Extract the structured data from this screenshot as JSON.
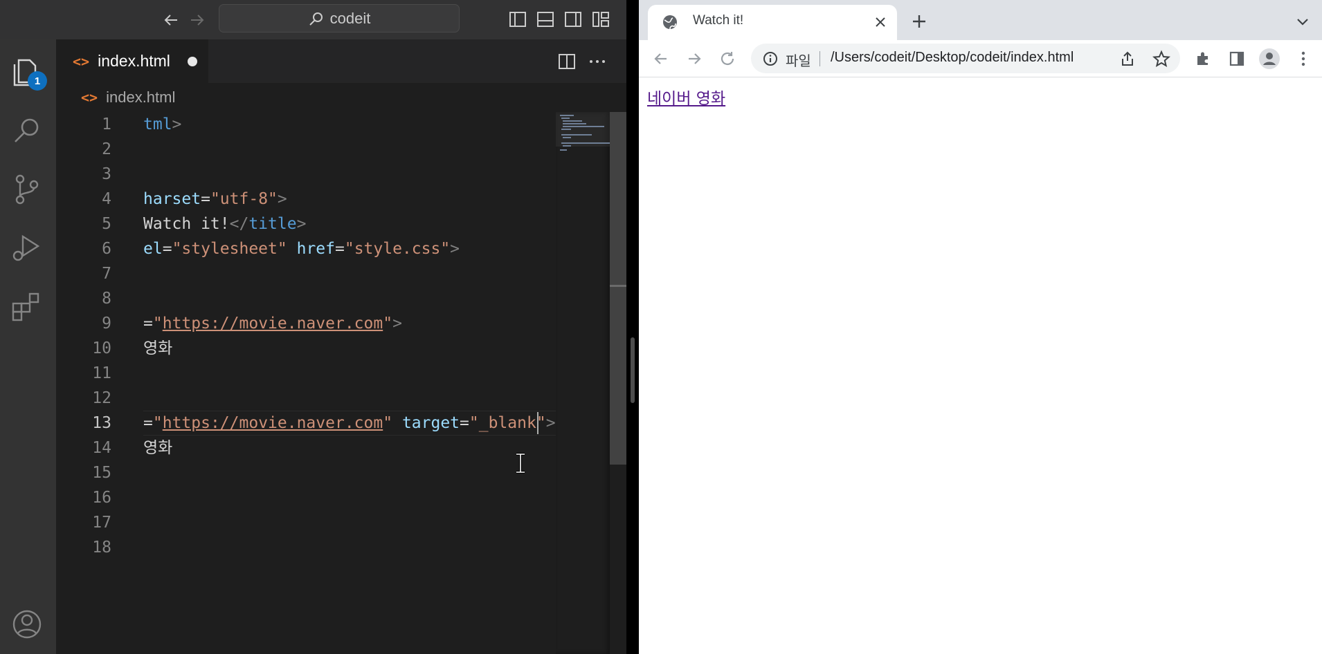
{
  "vscode": {
    "command_center": "codeit",
    "tab": {
      "label": "index.html",
      "icon": "<>"
    },
    "breadcrumb": "index.html",
    "badge": "1",
    "line_numbers": [
      "1",
      "2",
      "3",
      "4",
      "5",
      "6",
      "7",
      "8",
      "9",
      "10",
      "11",
      "12",
      "13",
      "14",
      "15",
      "16",
      "17",
      "18"
    ],
    "current_line": "13",
    "code": {
      "l1_name": "tml",
      "l4_attr": "harset",
      "l4_val": "\"utf-8\"",
      "l5_text": "Watch it!",
      "l5_tag": "title",
      "l6_attr1": "el",
      "l6_val1": "\"stylesheet\"",
      "l6_attr2": "href",
      "l6_val2": "\"style.css\"",
      "l9_val": "https://movie.naver.com",
      "l10_text": "영화",
      "l13_val": "https://movie.naver.com",
      "l13_attr": "target",
      "l13_val2": "\"_blank",
      "l14_text": "영화"
    }
  },
  "browser": {
    "tab_title": "Watch it!",
    "scheme_label": "파일",
    "url": "/Users/codeit/Desktop/codeit/index.html",
    "page_link": "네이버 영화"
  }
}
